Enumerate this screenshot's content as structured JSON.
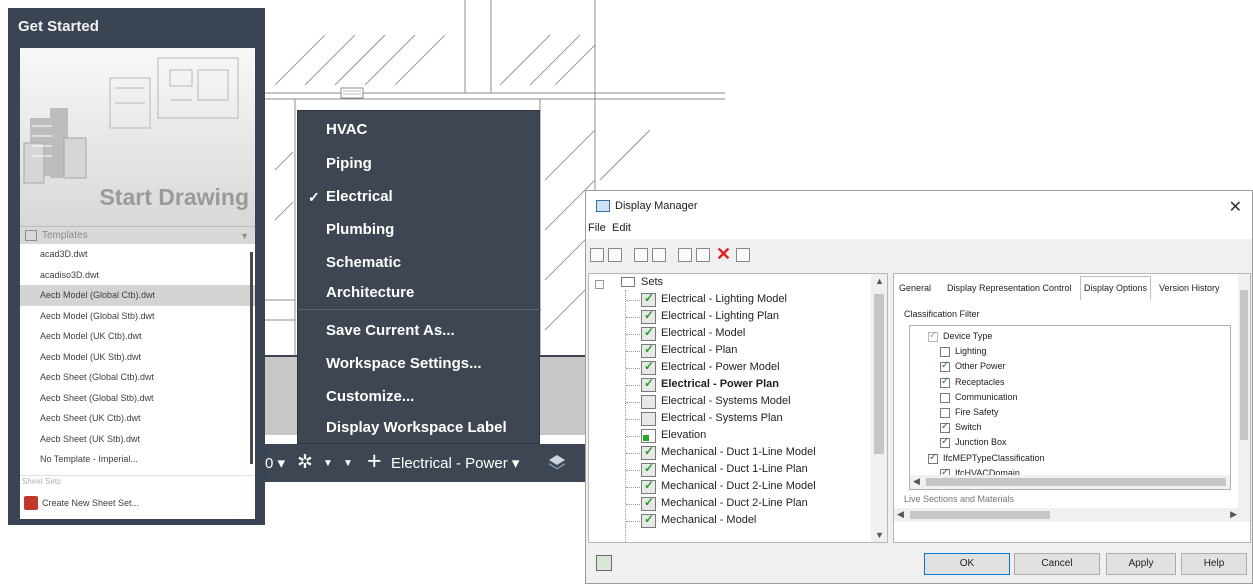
{
  "get_started": {
    "title": "Get Started",
    "start_drawing": "Start Drawing",
    "templates_label": "Templates",
    "templates": [
      "acad3D.dwt",
      "acadiso3D.dwt",
      "Aecb Model (Global Ctb).dwt",
      "Aecb Model (Global Stb).dwt",
      "Aecb Model (UK Ctb).dwt",
      "Aecb Model (UK Stb).dwt",
      "Aecb Sheet (Global Ctb).dwt",
      "Aecb Sheet (Global Stb).dwt",
      "Aecb Sheet (UK Ctb).dwt",
      "Aecb Sheet (UK Stb).dwt",
      "No Template - Imperial..."
    ],
    "sheet_sets_label": "Sheet Sets",
    "create_sheet_set": "Create New Sheet Set..."
  },
  "workspace_menu": {
    "items": [
      "HVAC",
      "Piping",
      "Electrical",
      "Plumbing",
      "Schematic",
      "Architecture"
    ],
    "checked": "Electrical",
    "actions": [
      "Save Current As...",
      "Workspace Settings...",
      "Customize...",
      "Display Workspace Label"
    ]
  },
  "status_bar": {
    "zero": "0",
    "workspace": "Electrical - Power"
  },
  "display_manager": {
    "title": "Display Manager",
    "menu": [
      "File",
      "Edit"
    ],
    "tree_root": "Sets",
    "tree_items": [
      {
        "label": "Electrical - Lighting Model",
        "icon": "set-check-icon"
      },
      {
        "label": "Electrical - Lighting Plan",
        "icon": "set-check-icon"
      },
      {
        "label": "Electrical - Model",
        "icon": "set-check-icon"
      },
      {
        "label": "Electrical - Plan",
        "icon": "set-check-icon"
      },
      {
        "label": "Electrical - Power Model",
        "icon": "set-check-icon"
      },
      {
        "label": "Electrical - Power Plan",
        "icon": "set-check-icon",
        "bold": true
      },
      {
        "label": "Electrical - Systems Model",
        "icon": "set-icon"
      },
      {
        "label": "Electrical - Systems Plan",
        "icon": "set-icon"
      },
      {
        "label": "Elevation",
        "icon": "elevation-icon"
      },
      {
        "label": "Mechanical - Duct 1-Line Model",
        "icon": "set-check-icon"
      },
      {
        "label": "Mechanical - Duct 1-Line Plan",
        "icon": "set-check-icon"
      },
      {
        "label": "Mechanical - Duct 2-Line Model",
        "icon": "set-check-icon"
      },
      {
        "label": "Mechanical - Duct 2-Line Plan",
        "icon": "set-check-icon"
      },
      {
        "label": "Mechanical - Model",
        "icon": "set-check-icon"
      }
    ],
    "tabs": [
      "General",
      "Display Representation Control",
      "Display Options",
      "Version History"
    ],
    "active_tab": "Display Options",
    "classification_filter_label": "Classification Filter",
    "filter_items": [
      {
        "label": "Device Type",
        "checked": true,
        "level": 0,
        "grey": true
      },
      {
        "label": "Lighting",
        "checked": false,
        "level": 1
      },
      {
        "label": "Other Power",
        "checked": true,
        "level": 1
      },
      {
        "label": "Receptacles",
        "checked": true,
        "level": 1
      },
      {
        "label": "Communication",
        "checked": false,
        "level": 1
      },
      {
        "label": "Fire Safety",
        "checked": false,
        "level": 1
      },
      {
        "label": "Switch",
        "checked": true,
        "level": 1
      },
      {
        "label": "Junction Box",
        "checked": true,
        "level": 1
      },
      {
        "label": "IfcMEPTypeClassification",
        "checked": true,
        "level": 0
      },
      {
        "label": "IfcHVACDomain",
        "checked": true,
        "level": 1
      }
    ],
    "sub_label": "Live Sections and Materials",
    "buttons": {
      "ok": "OK",
      "cancel": "Cancel",
      "apply": "Apply",
      "help": "Help"
    }
  },
  "colors": {
    "panel_dark": "#3e4553",
    "accent_blue": "#0078d7",
    "check_green": "#2aa12a",
    "delete_red": "#e02020"
  }
}
